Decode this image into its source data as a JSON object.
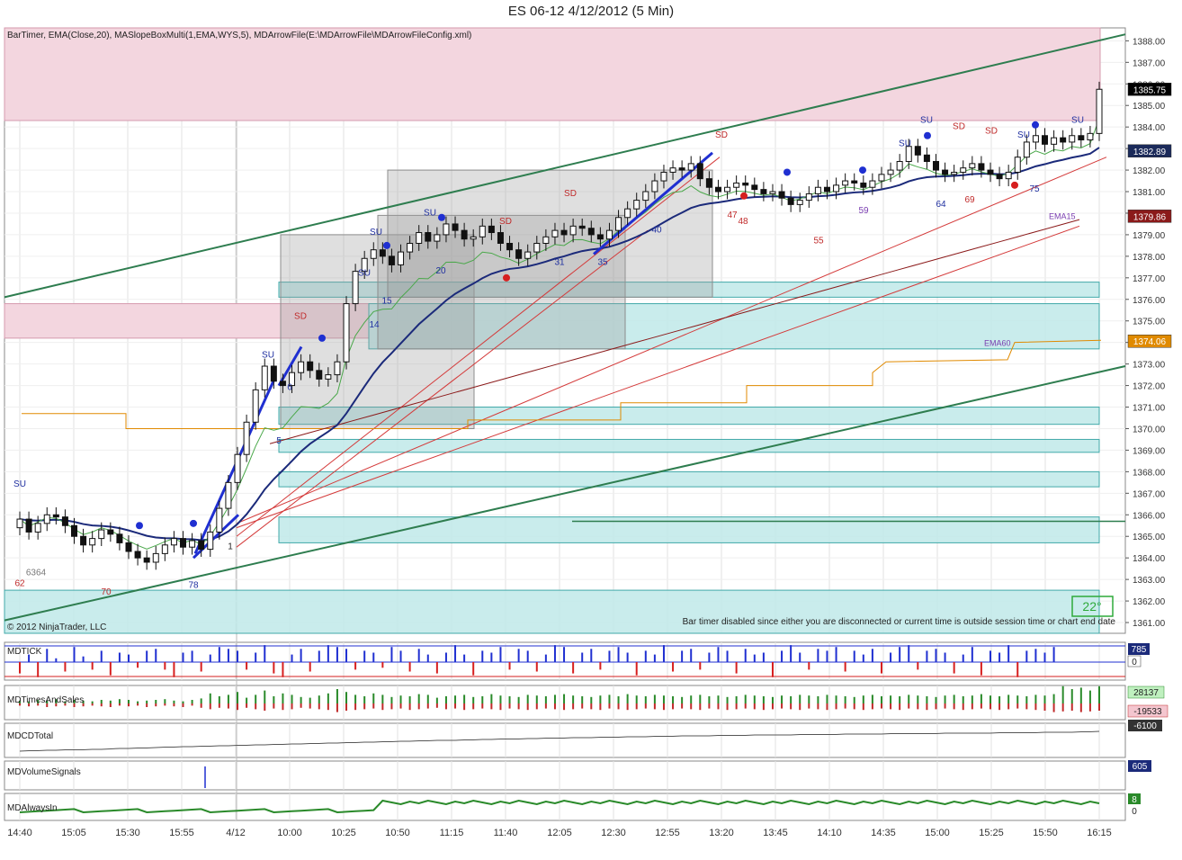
{
  "window": {
    "title": "ES 06-12  4/12/2012 (5 Min)"
  },
  "header_text": "BarTimer, EMA(Close,20), MASlopeBoxMulti(1,EMA,WYS,5), MDArrowFile(E:\\MDArrowFile\\MDArrowFileConfig.xml)",
  "copyright": "© 2012 NinjaTrader, LLC",
  "bar_timer_msg": "Bar timer disabled since either you are disconnected or current time is outside session time or chart end date",
  "angle_label": "22°",
  "ema15_label": "EMA15",
  "ema60_label": "EMA60",
  "chart_data": [
    {
      "type": "candlestick",
      "title": "ES 06-12  4/12/2012 (5 Min)",
      "ylim": [
        1360.5,
        1388.6
      ],
      "y_ticks": [
        1361,
        1362,
        1363,
        1364,
        1365,
        1366,
        1367,
        1368,
        1369,
        1370,
        1371,
        1372,
        1373,
        1374,
        1375,
        1376,
        1377,
        1378,
        1379,
        1380,
        1381,
        1382,
        1383,
        1384,
        1385,
        1386,
        1387,
        1388
      ],
      "y_tick_labels": [
        "1361.00",
        "1362.00",
        "1363.00",
        "1364.00",
        "1365.00",
        "1366.00",
        "1367.00",
        "1368.00",
        "1369.00",
        "1370.00",
        "1371.00",
        "1372.00",
        "1373.00",
        "1374.00",
        "1375.00",
        "1376.00",
        "1377.00",
        "1378.00",
        "1379.00",
        "1380.00",
        "1381.00",
        "1382.00",
        "1383.00",
        "1384.00",
        "1385.00",
        "1386.00",
        "1387.00",
        "1388.00"
      ],
      "x_tick_labels": [
        "14:40",
        "15:05",
        "15:30",
        "15:55",
        "4/12",
        "10:00",
        "10:25",
        "10:50",
        "11:15",
        "11:40",
        "12:05",
        "12:30",
        "12:55",
        "13:20",
        "13:45",
        "14:10",
        "14:35",
        "15:00",
        "15:25",
        "15:50",
        "16:15"
      ],
      "price_markers": [
        {
          "value": 1385.75,
          "label": "1385.75",
          "color": "#000000"
        },
        {
          "value": 1382.89,
          "label": "1382.89",
          "color": "#1b2a5a"
        },
        {
          "value": 1379.86,
          "label": "1379.86",
          "color": "#8b1a1a"
        },
        {
          "value": 1374.06,
          "label": "1374.06",
          "color": "#e08a00"
        }
      ],
      "close": [
        1365.8,
        1365.2,
        1365.6,
        1366.0,
        1365.9,
        1365.5,
        1365.0,
        1364.6,
        1364.9,
        1365.3,
        1365.1,
        1364.7,
        1364.3,
        1364.0,
        1363.8,
        1364.2,
        1364.6,
        1364.9,
        1364.5,
        1364.8,
        1364.4,
        1365.2,
        1366.3,
        1367.5,
        1368.8,
        1370.3,
        1371.8,
        1372.9,
        1372.2,
        1372.0,
        1372.6,
        1373.1,
        1372.7,
        1372.3,
        1372.5,
        1373.1,
        1375.8,
        1377.3,
        1377.9,
        1378.3,
        1378.0,
        1377.6,
        1378.2,
        1378.6,
        1379.1,
        1378.7,
        1379.0,
        1379.5,
        1379.2,
        1378.8,
        1378.9,
        1379.4,
        1379.1,
        1378.6,
        1378.3,
        1377.9,
        1378.2,
        1378.6,
        1378.9,
        1379.2,
        1379.0,
        1379.4,
        1379.3,
        1379.0,
        1378.8,
        1379.2,
        1379.8,
        1380.2,
        1380.6,
        1381.0,
        1381.5,
        1381.9,
        1382.1,
        1382.0,
        1382.3,
        1381.6,
        1381.2,
        1381.0,
        1381.2,
        1381.4,
        1381.3,
        1381.1,
        1380.9,
        1381.0,
        1380.7,
        1380.4,
        1380.6,
        1380.9,
        1381.2,
        1381.0,
        1381.3,
        1381.5,
        1381.4,
        1381.2,
        1381.5,
        1381.8,
        1382.0,
        1382.4,
        1383.1,
        1382.7,
        1382.4,
        1382.0,
        1381.8,
        1381.9,
        1382.1,
        1382.3,
        1382.0,
        1381.8,
        1381.6,
        1381.9,
        1382.6,
        1383.3,
        1383.6,
        1383.2,
        1383.5,
        1383.3,
        1383.6,
        1383.4,
        1383.7,
        1385.75
      ]
    },
    {
      "type": "bar",
      "title": "MDTICK",
      "last_value_label": "785",
      "zero_label": "0",
      "values": [
        -30,
        20,
        -40,
        35,
        10,
        -25,
        40,
        15,
        -20,
        30,
        -35,
        25,
        20,
        -15,
        30,
        35,
        -20,
        -40,
        25,
        30,
        -25,
        20,
        40,
        35,
        30,
        -20,
        25,
        45,
        -30,
        -40,
        20,
        35,
        -25,
        30,
        45,
        40,
        35,
        -20,
        30,
        25,
        -15,
        40,
        30,
        -25,
        35,
        20,
        -30,
        25,
        45,
        20,
        -35,
        30,
        25,
        40,
        -20,
        35,
        30,
        -25,
        20,
        45,
        40,
        -30,
        25,
        35,
        -20,
        30,
        40,
        25,
        -35,
        30,
        20,
        45,
        -25,
        30,
        35,
        -20,
        25,
        40,
        30,
        -30,
        35,
        20,
        25,
        -40,
        30,
        45,
        25,
        -20,
        35,
        30,
        40,
        -25,
        30,
        20,
        35,
        -30,
        25,
        40,
        45,
        -20,
        30,
        35,
        25,
        -30,
        20,
        40,
        -35,
        30,
        25,
        45,
        -40,
        30,
        35,
        25,
        40
      ]
    },
    {
      "type": "bar",
      "title": "MDTimesAndSales",
      "last_value_labels": [
        "28137",
        "-19533"
      ],
      "buy": [
        4,
        3,
        5,
        4,
        6,
        3,
        5,
        4,
        3,
        5,
        4,
        6,
        5,
        3,
        4,
        5,
        6,
        4,
        3,
        5,
        7,
        14,
        10,
        12,
        16,
        8,
        12,
        18,
        10,
        14,
        12,
        9,
        8,
        11,
        14,
        20,
        16,
        12,
        10,
        14,
        12,
        9,
        11,
        10,
        13,
        12,
        8,
        10,
        11,
        12,
        9,
        10,
        13,
        11,
        10,
        9,
        12,
        11,
        10,
        12,
        13,
        11,
        10,
        9,
        11,
        12,
        10,
        13,
        11,
        10,
        12,
        11,
        10,
        9,
        11,
        12,
        10,
        11,
        9,
        10,
        12,
        11,
        10,
        9,
        11,
        10,
        12,
        11,
        10,
        12,
        11,
        10,
        9,
        11,
        12,
        10,
        11,
        10,
        12,
        11,
        10,
        9,
        11,
        12,
        10,
        11,
        13,
        11,
        10,
        12,
        11,
        10,
        12,
        11,
        13,
        24,
        20,
        22,
        18,
        24
      ],
      "sell": [
        -3,
        -4,
        -3,
        -5,
        -4,
        -3,
        -5,
        -4,
        -3,
        -4,
        -5,
        -3,
        -4,
        -3,
        -5,
        -4,
        -3,
        -4,
        -5,
        -3,
        -6,
        -8,
        -6,
        -7,
        -9,
        -6,
        -8,
        -10,
        -7,
        -9,
        -8,
        -6,
        -7,
        -8,
        -9,
        -12,
        -10,
        -9,
        -8,
        -7,
        -9,
        -8,
        -7,
        -9,
        -8,
        -7,
        -6,
        -8,
        -7,
        -9,
        -8,
        -7,
        -8,
        -9,
        -7,
        -8,
        -9,
        -8,
        -7,
        -8,
        -9,
        -8,
        -7,
        -8,
        -9,
        -7,
        -8,
        -9,
        -8,
        -7,
        -8,
        -9,
        -8,
        -7,
        -8,
        -9,
        -7,
        -8,
        -9,
        -8,
        -7,
        -8,
        -9,
        -8,
        -7,
        -8,
        -9,
        -7,
        -8,
        -9,
        -8,
        -7,
        -8,
        -9,
        -8,
        -7,
        -8,
        -9,
        -7,
        -8,
        -9,
        -8,
        -7,
        -8,
        -9,
        -8,
        -7,
        -8,
        -9,
        -8,
        -7,
        -8,
        -9,
        -10,
        -12,
        -11,
        -10,
        -12,
        -11,
        -10
      ]
    },
    {
      "type": "line",
      "title": "MDCDTotal",
      "last_value_label": "-6100",
      "values": [
        -18,
        -17,
        -17,
        -16,
        -16,
        -15,
        -15,
        -15,
        -14,
        -14,
        -13,
        -12,
        -12,
        -11,
        -11,
        -10,
        -9,
        -9,
        -8,
        -8,
        -7,
        -7,
        -6,
        -6,
        -5,
        -5,
        -4,
        -4,
        -3,
        -3,
        -2,
        -2,
        -1,
        -1,
        0,
        0,
        1,
        1,
        2,
        2,
        3,
        3,
        4,
        4,
        5,
        5,
        6,
        6,
        6,
        7,
        7,
        8,
        8,
        9,
        9,
        9,
        10,
        10,
        11,
        11,
        11,
        12,
        12,
        12,
        13,
        13,
        13,
        14,
        14,
        14,
        15,
        15,
        15,
        16,
        16,
        16,
        16,
        17,
        17,
        17,
        17,
        18,
        18,
        18,
        18,
        18,
        19,
        19,
        19,
        19,
        19,
        20,
        20,
        20,
        20,
        20,
        21,
        21,
        21,
        21,
        21,
        21,
        22,
        22,
        22,
        22,
        22,
        22,
        23,
        23,
        23,
        23,
        23,
        24,
        24,
        24,
        24,
        25,
        25,
        26
      ]
    },
    {
      "type": "bar",
      "title": "MDVolumeSignals",
      "last_value_label": "605"
    },
    {
      "type": "line",
      "title": "MDAlwaysIn",
      "last_value_labels": [
        "8",
        "0"
      ]
    }
  ]
}
